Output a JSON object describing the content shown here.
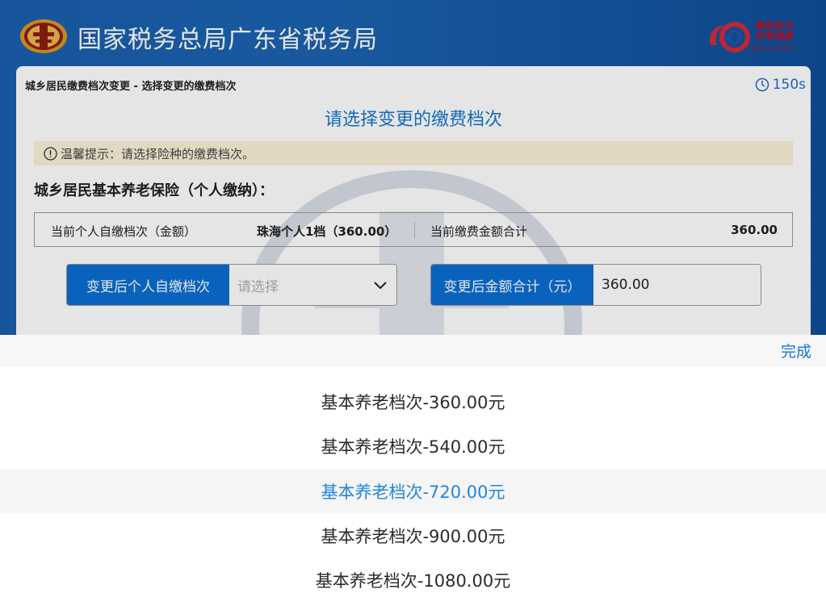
{
  "header": {
    "title": "国家税务总局广东省税务局",
    "slogan_line1": "粤税有为",
    "slogan_line2": "非常满意",
    "slogan_sub": "Highly Satisfied"
  },
  "panel": {
    "breadcrumb": "城乡居民缴费档次变更  -  选择变更的缴费档次",
    "timer": "150s",
    "heading": "请选择变更的缴费档次",
    "notice": "温馨提示：请选择险种的缴费档次。",
    "section_title": "城乡居民基本养老保险（个人缴纳）：",
    "info": {
      "current_level_label": "当前个人自缴档次（金额）",
      "current_level_value": "珠海个人1档（360.00）",
      "current_total_label": "当前缴费金额合计",
      "current_total_value": "360.00"
    },
    "level_field": {
      "label": "变更后个人自缴档次",
      "placeholder": "请选择"
    },
    "amount_field": {
      "label": "变更后金额合计（元）",
      "value": "360.00"
    }
  },
  "picker": {
    "done_label": "完成",
    "options": [
      "基本养老档次-360.00元",
      "基本养老档次-540.00元",
      "基本养老档次-720.00元",
      "基本养老档次-900.00元",
      "基本养老档次-1080.00元"
    ],
    "selected_index": 2
  },
  "colors": {
    "brand_blue": "#0b6fd3",
    "accent_blue": "#1677d2",
    "notice_bg": "#fbf1d8",
    "slogan_red": "#b8122a"
  }
}
